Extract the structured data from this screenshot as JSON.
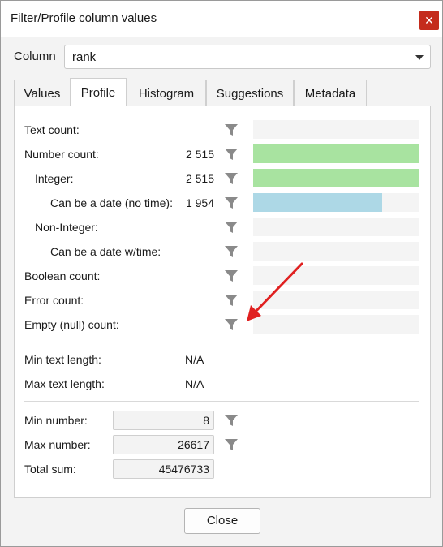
{
  "window": {
    "title": "Filter/Profile column values",
    "close_glyph": "✕"
  },
  "column": {
    "label": "Column",
    "value": "rank"
  },
  "tabs": [
    "Values",
    "Profile",
    "Histogram",
    "Suggestions",
    "Metadata"
  ],
  "active_tab": "Profile",
  "profile_rows": [
    {
      "label": "Text count:",
      "value": "",
      "fraction": 0
    },
    {
      "label": "Number count:",
      "value": "2 515",
      "fraction": 1.0,
      "color": "#a8e3a0"
    },
    {
      "label": "Integer:",
      "value": "2 515",
      "fraction": 1.0,
      "color": "#a8e3a0"
    },
    {
      "label": "Can be a date (no time):",
      "value": "1 954",
      "fraction": 0.777,
      "color": "#add8e6"
    },
    {
      "label": "Non-Integer:",
      "value": "",
      "fraction": 0
    },
    {
      "label": "Can be a date w/time:",
      "value": "",
      "fraction": 0
    },
    {
      "label": "Boolean count:",
      "value": "",
      "fraction": 0
    },
    {
      "label": "Error count:",
      "value": "",
      "fraction": 0
    },
    {
      "label": "Empty (null) count:",
      "value": "",
      "fraction": 0
    }
  ],
  "text_lengths": [
    {
      "label": "Min text length:",
      "value": "N/A"
    },
    {
      "label": "Max text length:",
      "value": "N/A"
    }
  ],
  "numbers": [
    {
      "label": "Min number:",
      "value": "8"
    },
    {
      "label": "Max number:",
      "value": "26617"
    },
    {
      "label": "Total sum:",
      "value": "45476733"
    }
  ],
  "buttons": {
    "close": "Close"
  },
  "icons": {
    "filter": "funnel-icon",
    "annotation": "red-arrow"
  },
  "colors": {
    "number_bar": "#a8e3a0",
    "date_bar": "#add8e6",
    "close_button": "#c42b1c",
    "arrow": "#e02020"
  }
}
